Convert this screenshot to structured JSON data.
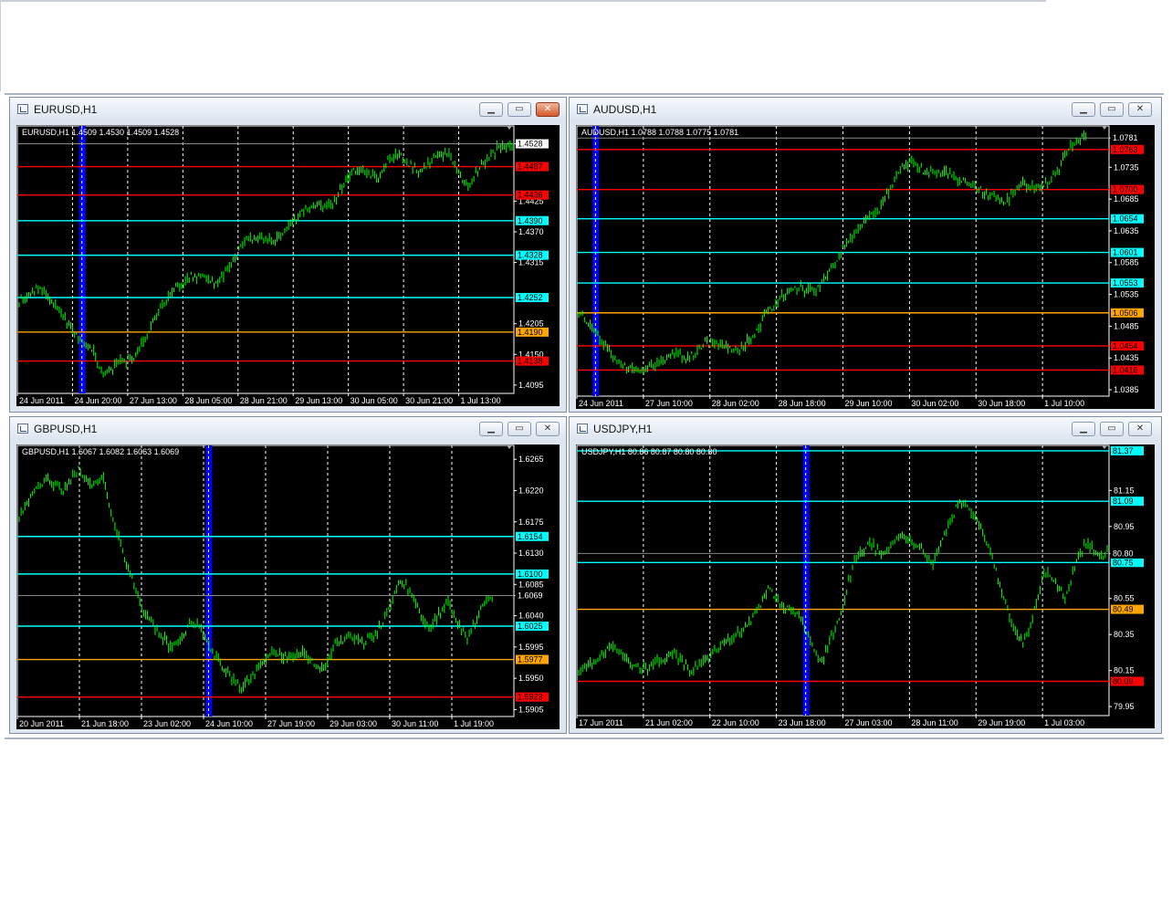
{
  "windows": [
    {
      "id": "eurusd",
      "title": "EURUSD,H1",
      "ohlc": "EURUSD,H1  1.4509 1.4530 1.4509 1.4528",
      "close_highlight": true,
      "chart_data": {
        "type": "candlestick",
        "ylim": [
          1.408,
          1.456
        ],
        "yticks": [
          1.4528,
          1.4425,
          1.437,
          1.4315,
          1.4205,
          1.415,
          1.4095
        ],
        "xticks": [
          "24 Jun 2011",
          "24 Jun 20:00",
          "27 Jun 13:00",
          "28 Jun 05:00",
          "28 Jun 21:00",
          "29 Jun 13:00",
          "30 Jun 05:00",
          "30 Jun 21:00",
          "1 Jul 13:00"
        ],
        "path": [
          [
            0,
            1.4245
          ],
          [
            4,
            1.427
          ],
          [
            8,
            1.423
          ],
          [
            12,
            1.418
          ],
          [
            15,
            1.416
          ],
          [
            17,
            1.411
          ],
          [
            20,
            1.4135
          ],
          [
            23,
            1.414
          ],
          [
            26,
            1.4185
          ],
          [
            29,
            1.424
          ],
          [
            32,
            1.427
          ],
          [
            35,
            1.429
          ],
          [
            38,
            1.429
          ],
          [
            40,
            1.4275
          ],
          [
            42,
            1.43
          ],
          [
            44,
            1.4325
          ],
          [
            46,
            1.436
          ],
          [
            49,
            1.436
          ],
          [
            52,
            1.4355
          ],
          [
            55,
            1.438
          ],
          [
            58,
            1.441
          ],
          [
            61,
            1.4415
          ],
          [
            64,
            1.4425
          ],
          [
            66,
            1.446
          ],
          [
            68,
            1.448
          ],
          [
            71,
            1.4475
          ],
          [
            73,
            1.4465
          ],
          [
            75,
            1.45
          ],
          [
            77,
            1.451
          ],
          [
            79,
            1.449
          ],
          [
            81,
            1.448
          ],
          [
            84,
            1.45
          ],
          [
            87,
            1.4515
          ],
          [
            89,
            1.448
          ],
          [
            91,
            1.445
          ],
          [
            94,
            1.449
          ],
          [
            97,
            1.452
          ],
          [
            100,
            1.4528
          ]
        ],
        "current_price": 1.4528,
        "levels": [
          {
            "label": "1.4487",
            "value": 1.4487,
            "color": "#ff0000"
          },
          {
            "label": "1.4436",
            "value": 1.4436,
            "color": "#ff0000"
          },
          {
            "label": "1.4390",
            "value": 1.439,
            "color": "#00ffff"
          },
          {
            "label": "1.4328",
            "value": 1.4328,
            "color": "#00ffff"
          },
          {
            "label": "1.4252",
            "value": 1.4252,
            "color": "#00ffff"
          },
          {
            "label": "1.4190",
            "value": 1.419,
            "color": "#ffa500"
          },
          {
            "label": "1.4138",
            "value": 1.4138,
            "color": "#ff0000"
          }
        ],
        "blue_marker_fraction": 0.13
      }
    },
    {
      "id": "audusd",
      "title": "AUDUSD,H1",
      "ohlc": "AUDUSD,H1  1.0788 1.0788 1.0775 1.0781",
      "close_highlight": false,
      "chart_data": {
        "type": "candlestick",
        "ylim": [
          1.0375,
          1.08
        ],
        "yticks": [
          1.0781,
          1.0735,
          1.0685,
          1.0635,
          1.0585,
          1.0535,
          1.0485,
          1.0435,
          1.0385
        ],
        "xticks": [
          "24 Jun 2011",
          "27 Jun 10:00",
          "28 Jun 02:00",
          "28 Jun 18:00",
          "29 Jun 10:00",
          "30 Jun 02:00",
          "30 Jun 18:00",
          "1 Jul 10:00"
        ],
        "path": [
          [
            0,
            1.051
          ],
          [
            3,
            1.048
          ],
          [
            6,
            1.044
          ],
          [
            9,
            1.042
          ],
          [
            12,
            1.0415
          ],
          [
            15,
            1.043
          ],
          [
            18,
            1.044
          ],
          [
            21,
            1.0435
          ],
          [
            24,
            1.046
          ],
          [
            27,
            1.0455
          ],
          [
            30,
            1.0445
          ],
          [
            33,
            1.047
          ],
          [
            36,
            1.051
          ],
          [
            39,
            1.0535
          ],
          [
            42,
            1.0545
          ],
          [
            45,
            1.054
          ],
          [
            48,
            1.058
          ],
          [
            51,
            1.062
          ],
          [
            54,
            1.065
          ],
          [
            57,
            1.067
          ],
          [
            59,
            1.07
          ],
          [
            61,
            1.0735
          ],
          [
            63,
            1.0745
          ],
          [
            66,
            1.0725
          ],
          [
            69,
            1.073
          ],
          [
            72,
            1.0715
          ],
          [
            75,
            1.0705
          ],
          [
            78,
            1.069
          ],
          [
            81,
            1.068
          ],
          [
            84,
            1.071
          ],
          [
            87,
            1.07
          ],
          [
            89,
            1.071
          ],
          [
            91,
            1.0735
          ],
          [
            93,
            1.0765
          ],
          [
            95,
            1.078
          ],
          [
            96,
            1.0781
          ]
        ],
        "current_price": 1.0781,
        "levels": [
          {
            "label": "1.0763",
            "value": 1.0763,
            "color": "#ff0000"
          },
          {
            "label": "1.0700",
            "value": 1.07,
            "color": "#ff0000"
          },
          {
            "label": "1.0654",
            "value": 1.0654,
            "color": "#00ffff"
          },
          {
            "label": "1.0601",
            "value": 1.0601,
            "color": "#00ffff"
          },
          {
            "label": "1.0553",
            "value": 1.0553,
            "color": "#00ffff"
          },
          {
            "label": "1.0506",
            "value": 1.0506,
            "color": "#ffa500"
          },
          {
            "label": "1.0454",
            "value": 1.0454,
            "color": "#ff0000"
          },
          {
            "label": "1.0416",
            "value": 1.0416,
            "color": "#ff0000"
          }
        ],
        "blue_marker_fraction": 0.035
      }
    },
    {
      "id": "gbpusd",
      "title": "GBPUSD,H1",
      "ohlc": "GBPUSD,H1  1.6067 1.6082 1.6063 1.6069",
      "close_highlight": false,
      "chart_data": {
        "type": "candlestick",
        "ylim": [
          1.5895,
          1.6285
        ],
        "yticks": [
          1.6265,
          1.622,
          1.6175,
          1.613,
          1.6085,
          1.6069,
          1.604,
          1.5995,
          1.595,
          1.5905
        ],
        "xticks": [
          "20 Jun 2011",
          "21 Jun 18:00",
          "23 Jun 02:00",
          "24 Jun 10:00",
          "27 Jun 19:00",
          "29 Jun 03:00",
          "30 Jun 11:00",
          "1 Jul 19:00"
        ],
        "path": [
          [
            0,
            1.618
          ],
          [
            3,
            1.622
          ],
          [
            6,
            1.6235
          ],
          [
            9,
            1.622
          ],
          [
            12,
            1.625
          ],
          [
            15,
            1.6225
          ],
          [
            17,
            1.624
          ],
          [
            19,
            1.618
          ],
          [
            21,
            1.613
          ],
          [
            23,
            1.609
          ],
          [
            25,
            1.605
          ],
          [
            27,
            1.603
          ],
          [
            29,
            1.601
          ],
          [
            31,
            1.599
          ],
          [
            33,
            1.601
          ],
          [
            35,
            1.603
          ],
          [
            37,
            1.602
          ],
          [
            39,
            1.599
          ],
          [
            42,
            1.596
          ],
          [
            45,
            1.5935
          ],
          [
            48,
            1.596
          ],
          [
            51,
            1.599
          ],
          [
            54,
            1.598
          ],
          [
            57,
            1.599
          ],
          [
            60,
            1.597
          ],
          [
            62,
            1.596
          ],
          [
            64,
            1.6
          ],
          [
            67,
            1.601
          ],
          [
            70,
            1.6
          ],
          [
            73,
            1.602
          ],
          [
            75,
            1.605
          ],
          [
            77,
            1.609
          ],
          [
            79,
            1.608
          ],
          [
            81,
            1.605
          ],
          [
            83,
            1.602
          ],
          [
            85,
            1.604
          ],
          [
            87,
            1.606
          ],
          [
            89,
            1.603
          ],
          [
            91,
            1.601
          ],
          [
            93,
            1.604
          ],
          [
            95,
            1.606
          ],
          [
            96,
            1.6069
          ]
        ],
        "current_price": 1.6069,
        "levels": [
          {
            "label": "1.6154",
            "value": 1.6154,
            "color": "#00ffff"
          },
          {
            "label": "1.6100",
            "value": 1.61,
            "color": "#00ffff"
          },
          {
            "label": "1.6025",
            "value": 1.6025,
            "color": "#00ffff"
          },
          {
            "label": "1.5977",
            "value": 1.5977,
            "color": "#ffa500"
          },
          {
            "label": "1.5923",
            "value": 1.5923,
            "color": "#ff0000"
          }
        ],
        "blue_marker_fraction": 0.385
      }
    },
    {
      "id": "usdjpy",
      "title": "USDJPY,H1",
      "ohlc": "USDJPY,H1  80.86 80.87 80.80 80.80",
      "close_highlight": false,
      "chart_data": {
        "type": "candlestick",
        "ylim": [
          79.9,
          81.4
        ],
        "yticks": [
          81.15,
          80.95,
          80.8,
          80.55,
          80.35,
          80.15,
          79.95
        ],
        "xticks": [
          "17 Jun 2011",
          "21 Jun 02:00",
          "22 Jun 10:00",
          "23 Jun 18:00",
          "27 Jun 03:00",
          "28 Jun 11:00",
          "29 Jun 19:00",
          "1 Jul 03:00"
        ],
        "path": [
          [
            0,
            80.15
          ],
          [
            3,
            80.2
          ],
          [
            6,
            80.28
          ],
          [
            9,
            80.22
          ],
          [
            12,
            80.15
          ],
          [
            15,
            80.2
          ],
          [
            18,
            80.25
          ],
          [
            21,
            80.15
          ],
          [
            24,
            80.2
          ],
          [
            27,
            80.3
          ],
          [
            30,
            80.35
          ],
          [
            33,
            80.45
          ],
          [
            36,
            80.6
          ],
          [
            39,
            80.5
          ],
          [
            42,
            80.45
          ],
          [
            44,
            80.3
          ],
          [
            46,
            80.2
          ],
          [
            48,
            80.35
          ],
          [
            50,
            80.5
          ],
          [
            52,
            80.75
          ],
          [
            55,
            80.85
          ],
          [
            58,
            80.8
          ],
          [
            61,
            80.9
          ],
          [
            64,
            80.85
          ],
          [
            67,
            80.75
          ],
          [
            70,
            80.95
          ],
          [
            72,
            81.1
          ],
          [
            74,
            81.05
          ],
          [
            76,
            80.95
          ],
          [
            78,
            80.8
          ],
          [
            80,
            80.6
          ],
          [
            82,
            80.4
          ],
          [
            84,
            80.3
          ],
          [
            86,
            80.45
          ],
          [
            88,
            80.7
          ],
          [
            90,
            80.65
          ],
          [
            92,
            80.55
          ],
          [
            94,
            80.75
          ],
          [
            96,
            80.85
          ],
          [
            98,
            80.8
          ],
          [
            100,
            80.8
          ]
        ],
        "current_price": 80.8,
        "levels": [
          {
            "label": "81.37",
            "value": 81.37,
            "color": "#00ffff"
          },
          {
            "label": "81.09",
            "value": 81.09,
            "color": "#00ffff"
          },
          {
            "label": "80.75",
            "value": 80.75,
            "color": "#00ffff"
          },
          {
            "label": "80.49",
            "value": 80.49,
            "color": "#ffa500"
          },
          {
            "label": "80.09",
            "value": 80.09,
            "color": "#ff0000"
          }
        ],
        "blue_marker_fraction": 0.43
      }
    }
  ],
  "icons": {
    "minimize": "minimize-icon",
    "restore": "restore-icon",
    "close": "close-icon",
    "chart": "chart-window-icon"
  }
}
